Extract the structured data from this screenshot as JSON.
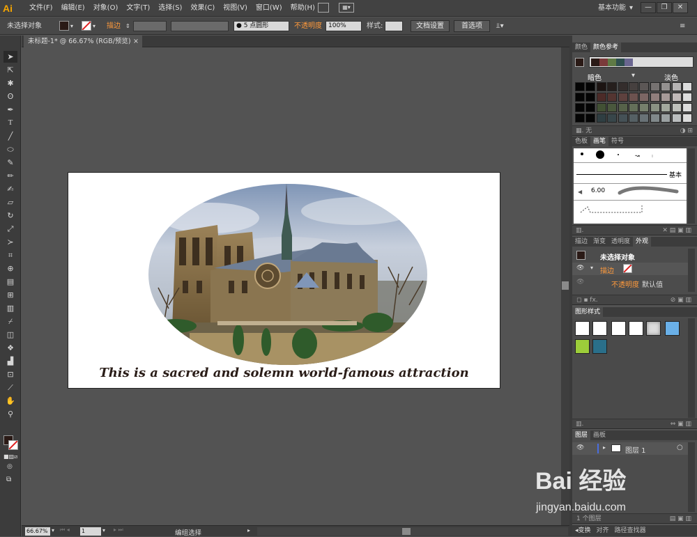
{
  "app": {
    "logo": "Ai",
    "workspace": "基本功能"
  },
  "menu": [
    "文件(F)",
    "编辑(E)",
    "对象(O)",
    "文字(T)",
    "选择(S)",
    "效果(C)",
    "视图(V)",
    "窗口(W)",
    "帮助(H)"
  ],
  "window_controls": {
    "minimize": "—",
    "restore": "❐",
    "close": "✕"
  },
  "control_bar": {
    "selection": "未选择对象",
    "stroke_label": "描边",
    "brush_value": "5 点圆形",
    "opacity_label": "不透明度",
    "opacity_value": "100%",
    "style_label": "样式:",
    "doc_setup": "文档设置",
    "preferences": "首选项"
  },
  "document": {
    "tab_title": "未标题-1* @ 66.67% (RGB/预览)",
    "tab_close": "×",
    "caption": "This is a sacred and solemn world-famous attraction"
  },
  "status": {
    "zoom": "66.67%",
    "page": "1",
    "mode": "编组选择"
  },
  "panels": {
    "color": {
      "tabs": [
        "颜色",
        "颜色参考"
      ],
      "left_label": "暗色",
      "right_label": "淡色",
      "none_label": "无"
    },
    "brush": {
      "tabs": [
        "色板",
        "画笔",
        "符号"
      ],
      "basic_label": "基本",
      "size_value": "6.00"
    },
    "appearance": {
      "tabs": [
        "描边",
        "渐变",
        "透明度",
        "外观"
      ],
      "title": "未选择对象",
      "stroke_label": "描边",
      "opacity_label": "不透明度",
      "opacity_value": "默认值"
    },
    "graphic_styles": {
      "tabs": [
        "图形样式"
      ]
    },
    "layers": {
      "tabs": [
        "图层",
        "画板"
      ],
      "layer_name": "图层 1",
      "count": "1 个图层"
    },
    "bottom": {
      "tabs": [
        "变换",
        "对齐",
        "路径查找器"
      ]
    }
  },
  "watermark": {
    "brand": "Bai 经验",
    "url": "jingyan.baidu.com"
  },
  "colors": {
    "accent_orange": "#ff9a3c",
    "logo": "#f7a600",
    "ui_dark": "#3c3c3c",
    "canvas": "#535353"
  },
  "icons": [
    "selection-tool-icon",
    "direct-selection-icon",
    "magic-wand-icon",
    "lasso-icon",
    "pen-icon",
    "type-icon",
    "line-icon",
    "ellipse-icon",
    "paintbrush-icon",
    "pencil-icon",
    "blob-brush-icon",
    "eraser-icon",
    "rotate-icon",
    "scale-icon",
    "width-icon",
    "free-transform-icon",
    "shape-builder-icon",
    "perspective-grid-icon",
    "mesh-icon",
    "gradient-icon",
    "eyedropper-icon",
    "blend-icon",
    "symbol-sprayer-icon",
    "column-graph-icon",
    "artboard-icon",
    "slice-icon",
    "hand-icon",
    "zoom-icon"
  ]
}
